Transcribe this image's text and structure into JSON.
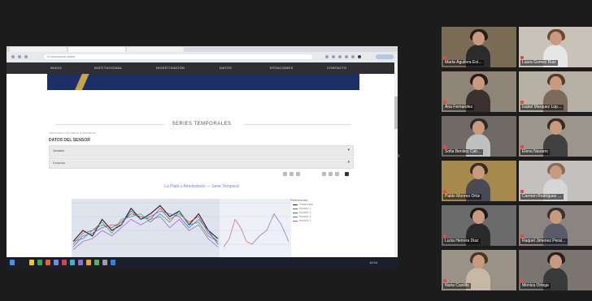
{
  "browser": {
    "address": "•• •••••••••••••• •••••••"
  },
  "site": {
    "nav": [
      "INICIO",
      "INSTITUCIONAL",
      "INVESTIGACIÓN",
      "DATOS",
      "ESTACIONES",
      "CONTACTO"
    ],
    "section_title": "SERIES TEMPORALES",
    "hint": "Seleccione los datos a visualizar",
    "filter_label": "DATOS DEL SENSOR",
    "select_1": "Variable",
    "select_2": "Estación",
    "chart_title": "La Plata y Alrededores — Serie Temporal"
  },
  "chart_data": {
    "type": "line",
    "title": "La Plata y Alrededores — Serie Temporal",
    "legend_title": "Referencias",
    "legend_position": "right",
    "grid": true,
    "series": [
      {
        "name": "Observado",
        "color": "#2b2b2b",
        "values": [
          0.3,
          0.5,
          0.4,
          0.7,
          0.5,
          0.6,
          0.9,
          0.7,
          0.8,
          0.95,
          0.75,
          0.85,
          0.6,
          0.8,
          0.5,
          0.35
        ]
      },
      {
        "name": "Modelo 1",
        "color": "#d43c3c",
        "values": [
          0.25,
          0.45,
          0.5,
          0.6,
          0.55,
          0.65,
          0.8,
          0.75,
          0.7,
          0.9,
          0.7,
          0.8,
          0.65,
          0.75,
          0.45,
          0.3
        ]
      },
      {
        "name": "Modelo 2",
        "color": "#3c64d4",
        "values": [
          0.2,
          0.4,
          0.45,
          0.55,
          0.6,
          0.6,
          0.85,
          0.7,
          0.75,
          0.85,
          0.8,
          0.75,
          0.55,
          0.7,
          0.5,
          0.25
        ]
      },
      {
        "name": "Modelo 3",
        "color": "#2ca05a",
        "values": [
          0.3,
          0.35,
          0.5,
          0.65,
          0.45,
          0.7,
          0.75,
          0.8,
          0.65,
          0.8,
          0.65,
          0.85,
          0.6,
          0.65,
          0.4,
          0.3
        ]
      },
      {
        "name": "Modelo 4",
        "color": "#9a5ad0",
        "values": [
          0.15,
          0.3,
          0.35,
          0.5,
          0.4,
          0.55,
          0.7,
          0.6,
          0.7,
          0.75,
          0.55,
          0.7,
          0.5,
          0.6,
          0.35,
          0.2
        ]
      }
    ],
    "forecast": [
      {
        "color": "#d8708a",
        "values": [
          0.2,
          0.35,
          0.7,
          0.55,
          0.3,
          0.25
        ]
      },
      {
        "color": "#8c7ae0",
        "values": [
          0.25,
          0.4,
          0.5,
          0.8,
          0.6,
          0.3
        ]
      }
    ]
  },
  "taskbar": {
    "icon_colors": [
      "#4a8fe7",
      "#f0c040",
      "#3aa35a",
      "#e0643c",
      "#6f8fd8",
      "#c94a4a",
      "#4ab0c9",
      "#8a6fd8",
      "#e8a33a",
      "#5fae5f",
      "#9aa0a6",
      "#3d7bd9"
    ],
    "time": "10:24"
  },
  "participants": [
    {
      "name": "Marta Aguilera Est…",
      "bg": "#7a6b55",
      "shirt": "#2b2b2b",
      "hair": "#2a1c12",
      "active": true
    },
    {
      "name": "Laura Gomez Ruiz",
      "bg": "#c9c2b8",
      "shirt": "#e6e6e6",
      "hair": "#6b4a30"
    },
    {
      "name": "Ana Fernandez",
      "bg": "#8f8577",
      "shirt": "#3a3030",
      "hair": "#2a1a12"
    },
    {
      "name": "Isabel Marquez Lop…",
      "bg": "#b7b0a4",
      "shirt": "#7c6a5a",
      "hair": "#5a3a2a"
    },
    {
      "name": "Sofia Benitez Cab…",
      "bg": "#6f6a66",
      "shirt": "#c0c0c0",
      "hair": "#2f2a26"
    },
    {
      "name": "Elena Navarro",
      "bg": "#9c958b",
      "shirt": "#404040",
      "hair": "#3a2a1e"
    },
    {
      "name": "Pablo Moreno Ortiz",
      "bg": "#a68a4d",
      "shirt": "#4a4a55",
      "hair": "#3a2a20"
    },
    {
      "name": "Carmen Rodríguez …",
      "bg": "#c3c1bd",
      "shirt": "#d6d6d6",
      "hair": "#8a6a50"
    },
    {
      "name": "Lucia Herrera Diaz",
      "bg": "#6b6b6b",
      "shirt": "#2a2a2a",
      "hair": "#1f1a16"
    },
    {
      "name": "Raquel Jimenez Peral…",
      "bg": "#8a8580",
      "shirt": "#5a5a6a",
      "hair": "#3a2f28"
    },
    {
      "name": "Nuria Castillo",
      "bg": "#9a9187",
      "shirt": "#c7b8a5",
      "hair": "#4a3426"
    },
    {
      "name": "Monica Ortega",
      "bg": "#7a7570",
      "shirt": "#3a3a3a",
      "hair": "#2a201a"
    }
  ]
}
